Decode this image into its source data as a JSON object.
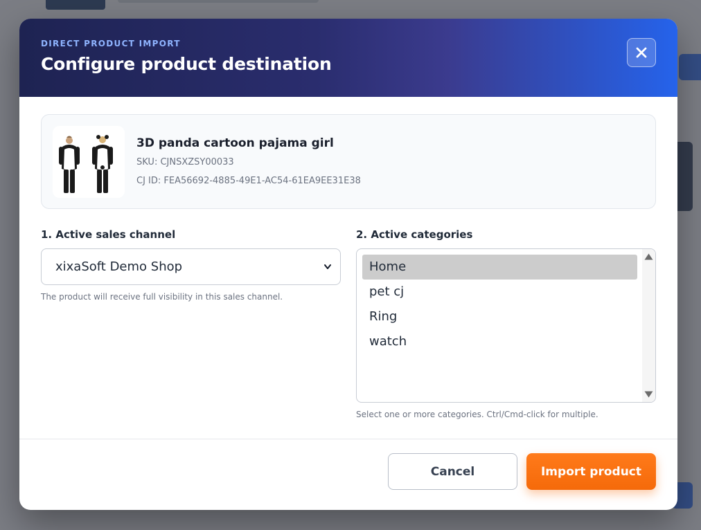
{
  "modal": {
    "eyebrow": "DIRECT PRODUCT IMPORT",
    "title": "Configure product destination",
    "close_icon": "close-icon"
  },
  "product": {
    "name": "3D panda cartoon pajama girl",
    "sku": "SKU: CJNSXZSY00033",
    "cj_id": "CJ ID: FEA56692-4885-49E1-AC54-61EA9EE31E38"
  },
  "sales_channel": {
    "label": "1. Active sales channel",
    "selected": "xixaSoft Demo Shop",
    "hint": "The product will receive full visibility in this sales channel."
  },
  "categories": {
    "label": "2. Active categories",
    "items": [
      {
        "label": "Home",
        "selected": true
      },
      {
        "label": "pet cj",
        "selected": false
      },
      {
        "label": "Ring",
        "selected": false
      },
      {
        "label": "watch",
        "selected": false
      }
    ],
    "hint": "Select one or more categories. Ctrl/Cmd-click for multiple."
  },
  "footer": {
    "cancel_label": "Cancel",
    "import_label": "Import product"
  },
  "colors": {
    "accent": "#f56a0a",
    "header_start": "#1e2352",
    "header_end": "#2563eb",
    "eyebrow": "#8fb4ff"
  }
}
